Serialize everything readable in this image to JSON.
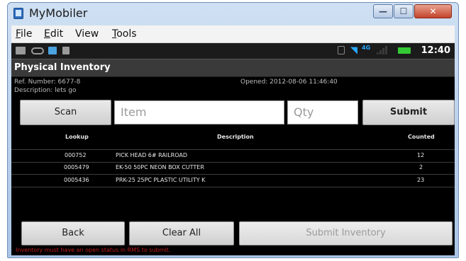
{
  "window": {
    "title": "MyMobiler",
    "controls": {
      "minimize": "—",
      "maximize": "☐",
      "close": "✕"
    }
  },
  "menubar": {
    "file": {
      "accel": "F",
      "rest": "ile"
    },
    "edit": {
      "accel": "E",
      "rest": "dit"
    },
    "view": {
      "label": "View"
    },
    "tools": {
      "accel": "T",
      "rest": "ools"
    }
  },
  "statusbar": {
    "time": "12:40",
    "network": "4G",
    "icons": [
      "keyboard-icon",
      "voicemail-icon",
      "app-icon",
      "usb-icon",
      "vibrate-icon",
      "wifi-icon",
      "network-icon",
      "signal-icon",
      "battery-icon"
    ]
  },
  "screen": {
    "title": "Physical Inventory",
    "ref_number": "Ref. Number: 6677-8",
    "description": "Description: lets go",
    "opened": "Opened: 2012-08-06 11:46:40"
  },
  "controls": {
    "scan_label": "Scan",
    "item_placeholder": "Item",
    "qty_placeholder": "Qty",
    "submit_label": "Submit"
  },
  "table": {
    "headers": {
      "lookup": "Lookup",
      "description": "Description",
      "counted": "Counted"
    },
    "rows": [
      {
        "lookup": "000752",
        "description": "PICK HEAD 6# RAILROAD",
        "counted": "12"
      },
      {
        "lookup": "0005479",
        "description": "EK-50 50PC NEON BOX CUTTER",
        "counted": "2"
      },
      {
        "lookup": "0005436",
        "description": "PRK-25 25PC PLASTIC UTILITY K",
        "counted": "23"
      }
    ]
  },
  "footer": {
    "back_label": "Back",
    "clear_label": "Clear All",
    "submit_inventory_label": "Submit Inventory",
    "warning": "Inventory must have an open status in RMS to submit."
  },
  "colors": {
    "window_frame": "#a9c4e6",
    "close_button": "#c4432b",
    "screen_bg": "#000000",
    "warning_text": "#c11e1e",
    "status_accent": "#2aa8ff",
    "battery": "#34c934"
  }
}
